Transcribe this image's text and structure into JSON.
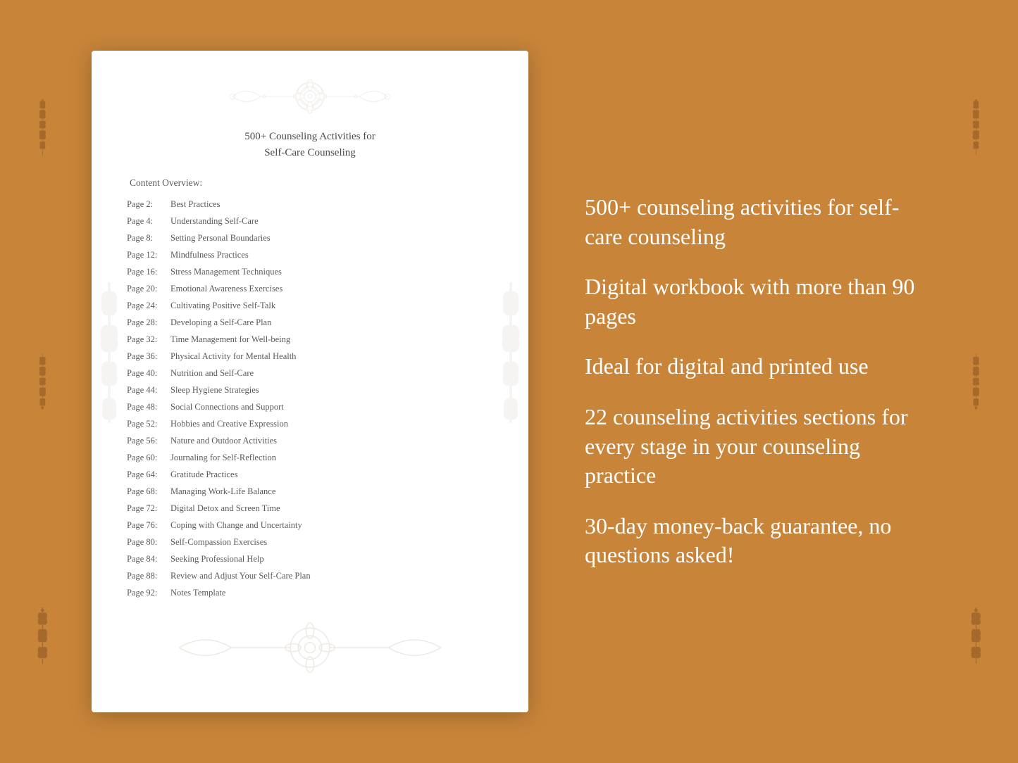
{
  "background_color": "#C8853A",
  "document": {
    "title_line1": "500+ Counseling Activities for",
    "title_line2": "Self-Care Counseling",
    "content_overview_label": "Content Overview:",
    "toc_items": [
      {
        "page": "Page  2:",
        "title": "Best Practices"
      },
      {
        "page": "Page  4:",
        "title": "Understanding Self-Care"
      },
      {
        "page": "Page  8:",
        "title": "Setting Personal Boundaries"
      },
      {
        "page": "Page 12:",
        "title": "Mindfulness Practices"
      },
      {
        "page": "Page 16:",
        "title": "Stress Management Techniques"
      },
      {
        "page": "Page 20:",
        "title": "Emotional Awareness Exercises"
      },
      {
        "page": "Page 24:",
        "title": "Cultivating Positive Self-Talk"
      },
      {
        "page": "Page 28:",
        "title": "Developing a Self-Care Plan"
      },
      {
        "page": "Page 32:",
        "title": "Time Management for Well-being"
      },
      {
        "page": "Page 36:",
        "title": "Physical Activity for Mental Health"
      },
      {
        "page": "Page 40:",
        "title": "Nutrition and Self-Care"
      },
      {
        "page": "Page 44:",
        "title": "Sleep Hygiene Strategies"
      },
      {
        "page": "Page 48:",
        "title": "Social Connections and Support"
      },
      {
        "page": "Page 52:",
        "title": "Hobbies and Creative Expression"
      },
      {
        "page": "Page 56:",
        "title": "Nature and Outdoor Activities"
      },
      {
        "page": "Page 60:",
        "title": "Journaling for Self-Reflection"
      },
      {
        "page": "Page 64:",
        "title": "Gratitude Practices"
      },
      {
        "page": "Page 68:",
        "title": "Managing Work-Life Balance"
      },
      {
        "page": "Page 72:",
        "title": "Digital Detox and Screen Time"
      },
      {
        "page": "Page 76:",
        "title": "Coping with Change and Uncertainty"
      },
      {
        "page": "Page 80:",
        "title": "Self-Compassion Exercises"
      },
      {
        "page": "Page 84:",
        "title": "Seeking Professional Help"
      },
      {
        "page": "Page 88:",
        "title": "Review and Adjust Your Self-Care Plan"
      },
      {
        "page": "Page 92:",
        "title": "Notes Template"
      }
    ]
  },
  "features": [
    "500+ counseling activities for self-care counseling",
    "Digital workbook with more than 90 pages",
    "Ideal for digital and printed use",
    "22 counseling activities sections for every stage in your counseling practice",
    "30-day money-back guarantee, no questions asked!"
  ]
}
